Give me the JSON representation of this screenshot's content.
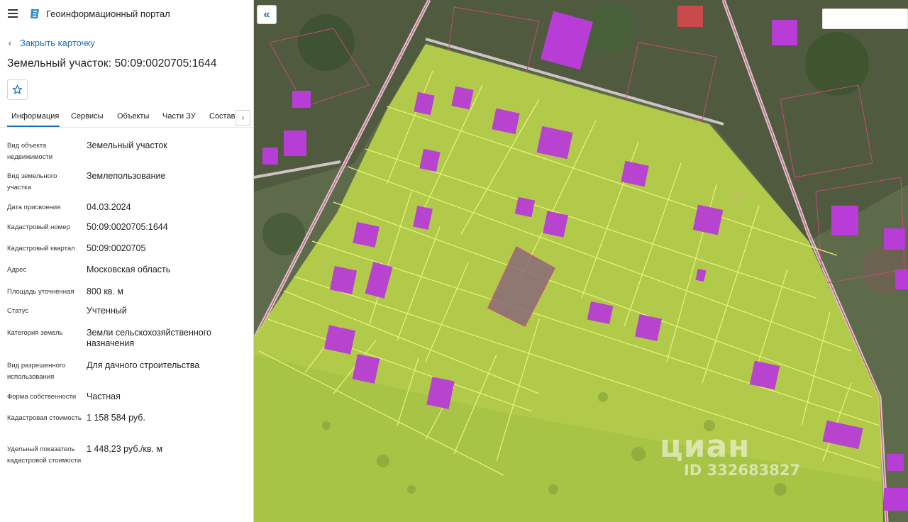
{
  "header": {
    "portal_title": "Геоинформационный портал"
  },
  "card": {
    "close_label": "Закрыть карточку",
    "title": "Земельный участок: 50:09:0020705:1644"
  },
  "tabs": [
    {
      "label": "Информация"
    },
    {
      "label": "Сервисы"
    },
    {
      "label": "Объекты"
    },
    {
      "label": "Части ЗУ"
    },
    {
      "label": "Состав"
    }
  ],
  "attributes": [
    {
      "label": "Вид объекта недвижимости",
      "value": "Земельный участок"
    },
    {
      "label": "Вид земельного участка",
      "value": "Землепользование"
    },
    {
      "label": "Дата присвоения",
      "value": "04.03.2024"
    },
    {
      "label": "Кадастровый номер",
      "value": "50:09:0020705:1644"
    },
    {
      "label": "Кадастровый квартал",
      "value": "50:09:0020705"
    },
    {
      "label": "Адрес",
      "value": "Московская область"
    },
    {
      "label": "Площадь уточненная",
      "value": "800 кв. м"
    },
    {
      "label": "Статус",
      "value": "Учтенный"
    },
    {
      "label": "Категория земель",
      "value": "Земли сельскохозяйственного назначения"
    },
    {
      "label": "Вид разрешенного использования",
      "value": "Для дачного строительства"
    },
    {
      "label": "Форма собственности",
      "value": "Частная"
    },
    {
      "label": "Кадастровая стоимость",
      "value": "1 158 584 руб."
    },
    {
      "label": "Удельный показатель кадастровой стоимости",
      "value": "1 448,23 руб./кв. м"
    }
  ],
  "map": {
    "watermark_brand": "циан",
    "watermark_id": "ID 332683827"
  },
  "colors": {
    "accent": "#1a6fb8",
    "parcel_fill": "#b9d34a",
    "parcel_line": "#e8f07a",
    "building_fill": "#b83cd6",
    "selected_parcel": "#8a6a78"
  },
  "icons": {
    "menu": "hamburger-icon",
    "logo": "portal-logo-icon",
    "back": "chevron-left-icon",
    "favorite": "star-icon",
    "tabs_next": "chevron-right-icon",
    "collapse": "double-chevron-left-icon"
  }
}
